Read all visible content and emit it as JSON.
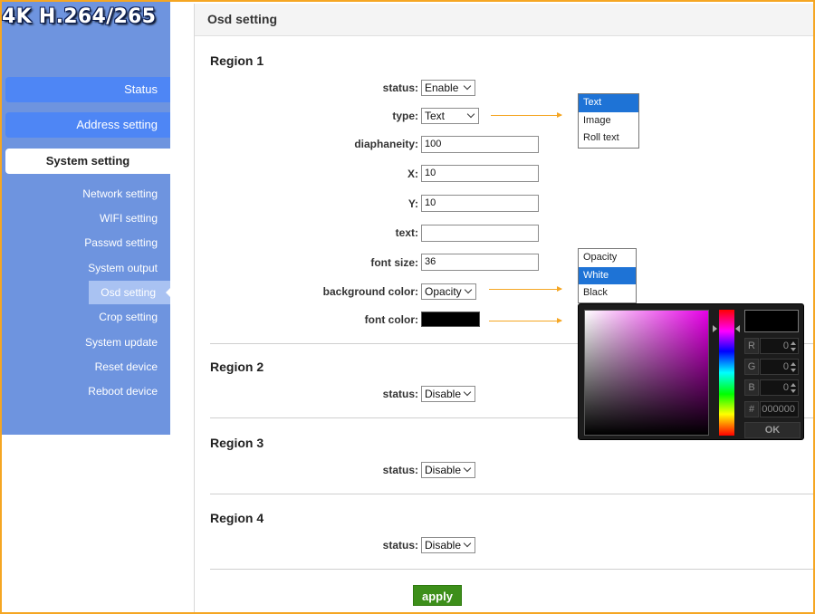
{
  "brand": "4K H.264/265",
  "sidebar": {
    "main": [
      {
        "label": "Status"
      },
      {
        "label": "Address setting"
      },
      {
        "label": "System setting"
      }
    ],
    "sub": [
      {
        "label": "Network setting"
      },
      {
        "label": "WIFI setting"
      },
      {
        "label": "Passwd setting"
      },
      {
        "label": "System output"
      },
      {
        "label": "Osd setting"
      },
      {
        "label": "Crop setting"
      },
      {
        "label": "System update"
      },
      {
        "label": "Reset device"
      },
      {
        "label": "Reboot device"
      }
    ]
  },
  "panel": {
    "title": "Osd setting",
    "region1": {
      "title": "Region 1",
      "status_label": "status:",
      "status_value": "Enable",
      "type_label": "type:",
      "type_value": "Text",
      "diaphaneity_label": "diaphaneity:",
      "diaphaneity_value": "100",
      "x_label": "X:",
      "x_value": "10",
      "y_label": "Y:",
      "y_value": "10",
      "text_label": "text:",
      "text_value": "",
      "fontsize_label": "font size:",
      "fontsize_value": "36",
      "bg_label": "background color:",
      "bg_value": "Opacity",
      "fontcolor_label": "font color:"
    },
    "region2": {
      "title": "Region 2",
      "status_label": "status:",
      "status_value": "Disable"
    },
    "region3": {
      "title": "Region 3",
      "status_label": "status:",
      "status_value": "Disable"
    },
    "region4": {
      "title": "Region 4",
      "status_label": "status:",
      "status_value": "Disable"
    },
    "apply_label": "apply"
  },
  "type_dropdown": {
    "options": [
      "Text",
      "Image",
      "Roll text"
    ],
    "highlighted": "Text"
  },
  "bg_dropdown": {
    "options": [
      "Opacity",
      "White",
      "Black"
    ],
    "highlighted": "White"
  },
  "color_picker": {
    "r_label": "R",
    "r_value": "0",
    "g_label": "G",
    "g_value": "0",
    "b_label": "B",
    "b_value": "0",
    "hex_label": "#",
    "hex_value": "000000",
    "ok_label": "OK",
    "current_color": "#000000"
  },
  "colors": {
    "accent": "#4e86f5",
    "sidebar": "#6e94df",
    "apply": "#3d8f1a",
    "arrow": "#f5a623"
  }
}
